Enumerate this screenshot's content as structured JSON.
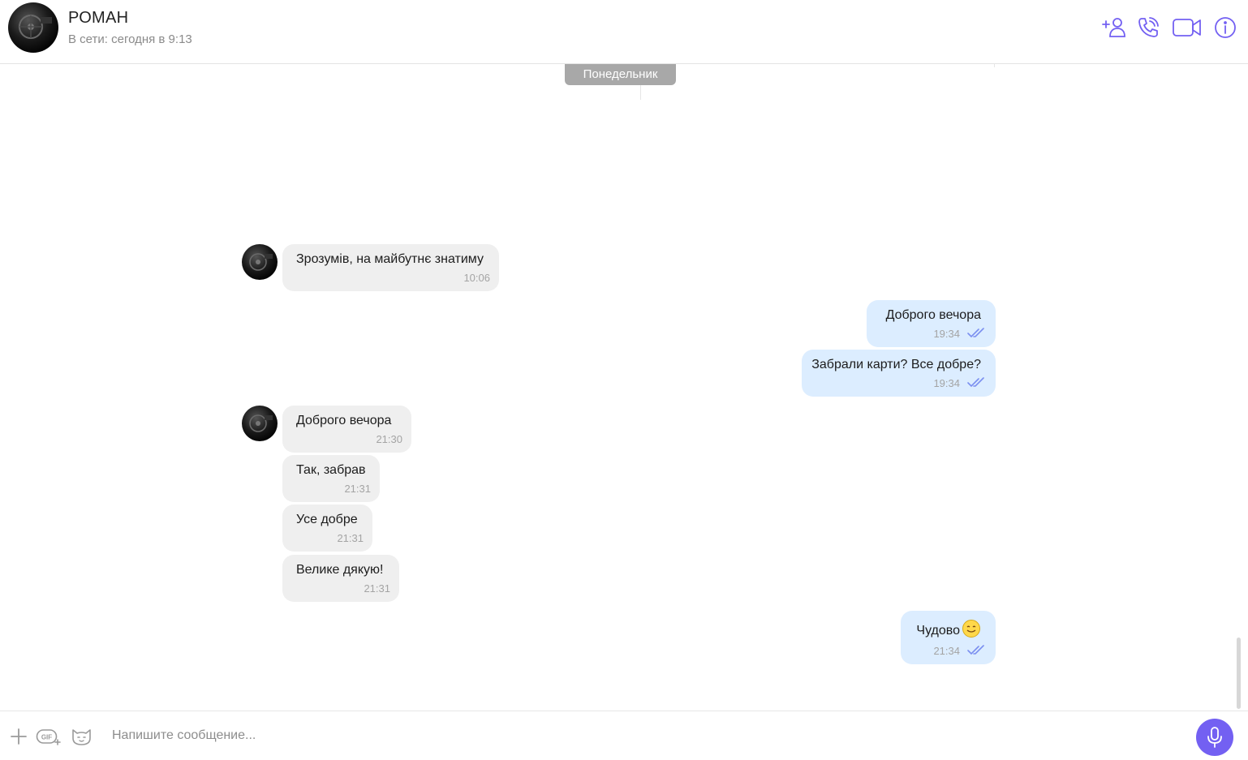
{
  "header": {
    "contact_name": "РОМАН",
    "status": "В сети: сегодня в 9:13",
    "icons": [
      "add-contact-icon",
      "phone-icon",
      "video-icon",
      "info-icon"
    ],
    "accent_color": "#7360f2"
  },
  "chat": {
    "day_label": "Понедельник",
    "messages": [
      {
        "direction": "in",
        "text": "Зрозумів, на майбутнє знатиму",
        "time": "10:06"
      },
      {
        "direction": "out",
        "text": "Доброго вечора",
        "time": "19:34"
      },
      {
        "direction": "out",
        "text": "Забрали карти? Все добре?",
        "time": "19:34"
      },
      {
        "direction": "in",
        "text": "Доброго вечора",
        "time": "21:30"
      },
      {
        "direction": "in",
        "text": "Так, забрав",
        "time": "21:31"
      },
      {
        "direction": "in",
        "text": "Усе добре",
        "time": "21:31"
      },
      {
        "direction": "in",
        "text": "Велике дякую!",
        "time": "21:31"
      },
      {
        "direction": "out",
        "text": "Чудово",
        "time": "21:34",
        "emoji": "smile-emoji"
      }
    ]
  },
  "composer": {
    "placeholder": "Напишите сообщение...",
    "icons": [
      "plus-icon",
      "gif-icon",
      "sticker-icon",
      "microphone-icon"
    ]
  },
  "colors": {
    "incoming_bubble": "#efefef",
    "outgoing_bubble": "#dcedff",
    "read_check": "#7b8ff0",
    "day_chip": "#a8a8a8"
  }
}
